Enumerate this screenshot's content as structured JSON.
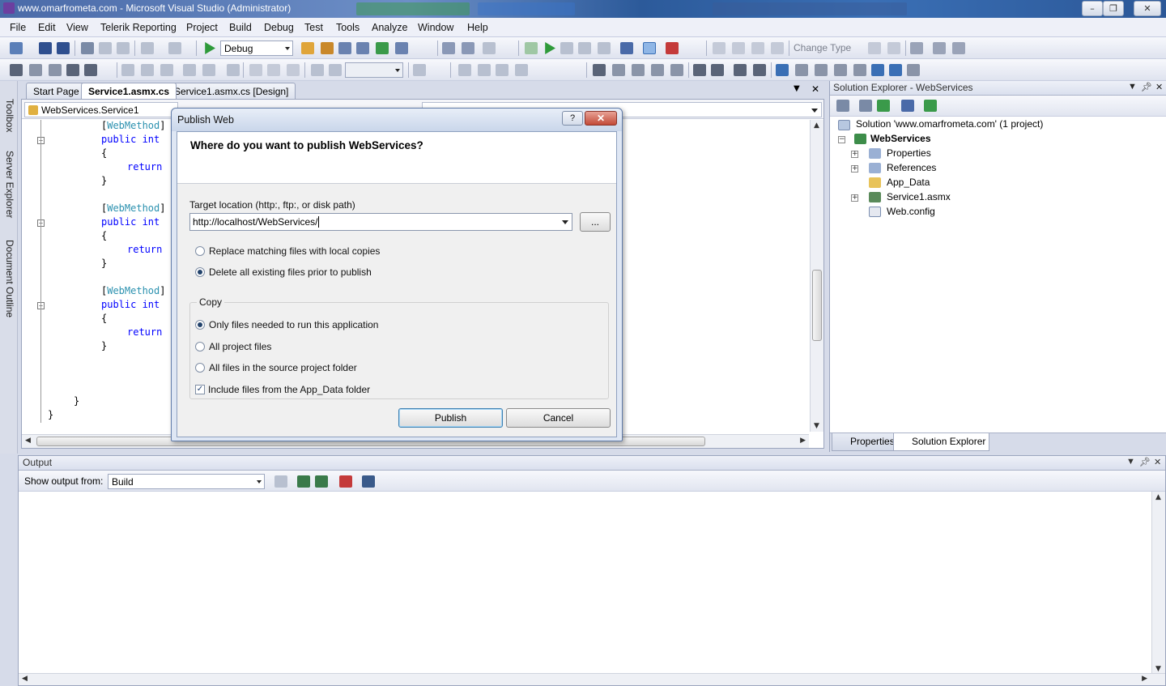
{
  "window": {
    "title": "www.omarfrometa.com - Microsoft Visual Studio (Administrator)",
    "buttons": {
      "minimize": "–",
      "maximize": "❐",
      "close": "✕"
    }
  },
  "menu": [
    "File",
    "Edit",
    "View",
    "Telerik Reporting",
    "Project",
    "Build",
    "Debug",
    "Test",
    "Tools",
    "Analyze",
    "Window",
    "Help"
  ],
  "toolbar": {
    "config": "Debug",
    "change_type": "Change Type"
  },
  "left_sidebar": [
    "Toolbox",
    "Server Explorer",
    "Document Outline"
  ],
  "doc_tabs": [
    "Start Page",
    "Service1.asmx.cs",
    "Service1.asmx.cs [Design]"
  ],
  "editor": {
    "nav_left": "WebServices.Service1",
    "lines": [
      {
        "prefix": "[",
        "type": "WebMethod",
        "suffix": "]"
      },
      {
        "kw": "public int",
        "rest": ""
      },
      {
        "text": "{"
      },
      {
        "kw": "return",
        "rest": "",
        "indent": true
      },
      {
        "text": "}"
      },
      {
        "text": ""
      },
      {
        "prefix": "[",
        "type": "WebMethod",
        "suffix": "]"
      },
      {
        "kw": "public int",
        "rest": ""
      },
      {
        "text": "{"
      },
      {
        "kw": "return",
        "rest": "",
        "indent": true
      },
      {
        "text": "}"
      },
      {
        "text": ""
      },
      {
        "prefix": "[",
        "type": "WebMethod",
        "suffix": "]"
      },
      {
        "kw": "public int",
        "rest": ""
      },
      {
        "text": "{"
      },
      {
        "kw": "return",
        "rest": "",
        "indent": true
      },
      {
        "text": "}"
      },
      {
        "text": ""
      },
      {
        "text": ""
      },
      {
        "text": ""
      },
      {
        "text": "}",
        "outer": 1
      },
      {
        "text": "}",
        "outer": 2
      }
    ]
  },
  "solution_explorer": {
    "title": "Solution Explorer - WebServices",
    "solution": "Solution 'www.omarfrometa.com' (1 project)",
    "project": "WebServices",
    "items": [
      "Properties",
      "References",
      "App_Data",
      "Service1.asmx",
      "Web.config"
    ],
    "bottom_tabs": [
      "Properties",
      "Solution Explorer"
    ]
  },
  "output": {
    "title": "Output",
    "show_from_label": "Show output from:",
    "show_from_value": "Build"
  },
  "dialog": {
    "title": "Publish Web",
    "help": "?",
    "close": "✕",
    "question": "Where do you want to publish WebServices?",
    "target_label": "Target location (http:, ftp:, or disk path)",
    "target_value": "http://localhost/WebServices/",
    "browse": "...",
    "replace_option": "Replace matching files with local copies",
    "delete_option": "Delete all existing files prior to publish",
    "copy_label": "Copy",
    "copy_options": [
      "Only files needed to run this application",
      "All project files",
      "All files in the source project folder"
    ],
    "include_app_data": "Include files from the App_Data folder",
    "publish": "Publish",
    "cancel": "Cancel"
  },
  "colors": {
    "keyword": "#0000ff",
    "type": "#2b91af",
    "title_bar": "#4a6aa8"
  }
}
